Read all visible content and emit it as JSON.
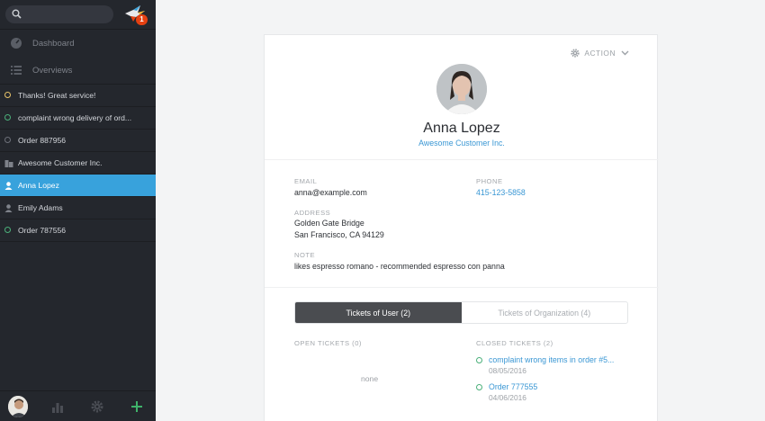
{
  "sidebar": {
    "notification_count": "1",
    "nav": [
      {
        "label": "Dashboard",
        "icon": "dashboard-icon"
      },
      {
        "label": "Overviews",
        "icon": "list-icon"
      }
    ],
    "tasks": [
      {
        "label": "Thanks! Great service!",
        "icon": "ticket-open-icon",
        "color": "#e9c46a"
      },
      {
        "label": "complaint wrong delivery of ord...",
        "icon": "ticket-open-icon",
        "color": "#4bb07a"
      },
      {
        "label": "Order 887956",
        "icon": "ticket-closed-icon",
        "color": "#6d7079"
      },
      {
        "label": "Awesome Customer Inc.",
        "icon": "organization-icon"
      },
      {
        "label": "Anna Lopez",
        "icon": "user-icon",
        "active": true
      },
      {
        "label": "Emily Adams",
        "icon": "user-icon"
      },
      {
        "label": "Order 787556",
        "icon": "ticket-open-icon",
        "color": "#4bb07a"
      }
    ],
    "bottom_icons": [
      "user-avatar",
      "stats-icon",
      "gear-icon",
      "plus-icon"
    ]
  },
  "profile": {
    "action_label": "ACTION",
    "name": "Anna Lopez",
    "organization": "Awesome Customer Inc.",
    "email_label": "EMAIL",
    "email": "anna@example.com",
    "phone_label": "PHONE",
    "phone": "415-123-5858",
    "address_label": "ADDRESS",
    "address_line1": "Golden Gate Bridge",
    "address_line2": "San Francisco, CA 94129",
    "note_label": "NOTE",
    "note": "likes espresso romano - recommended espresso con panna"
  },
  "tabs": [
    {
      "label": "Tickets of User (2)",
      "active": true
    },
    {
      "label": "Tickets of Organization (4)",
      "active": false
    }
  ],
  "tickets": {
    "open_header": "OPEN TICKETS (0)",
    "open_empty": "none",
    "closed_header": "CLOSED TICKETS (2)",
    "closed": [
      {
        "title": "complaint wrong items in order #5...",
        "date": "08/05/2016"
      },
      {
        "title": "Order 777555",
        "date": "04/06/2016"
      }
    ]
  },
  "colors": {
    "accent": "#38a2dc",
    "link": "#3a97d4",
    "sidebar_bg": "#24272d",
    "open_green": "#4bb07a"
  }
}
